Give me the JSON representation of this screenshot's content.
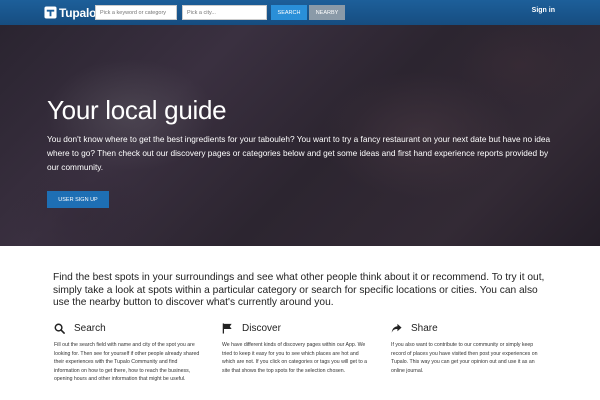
{
  "header": {
    "brand": "Tupalo",
    "search_placeholder": "Pick a keyword or category",
    "city_placeholder": "Pick a city...",
    "search_label": "SEARCH",
    "nearby_label": "NEARBY",
    "signin_label": "Sign in"
  },
  "hero": {
    "title": "Your local guide",
    "text": "You don't know where to get the best ingredients for your tabouleh? You want to try a fancy restaurant on your next date but have no idea where to go? Then check out our discovery pages or categories below and get some ideas and first hand experience reports provided by our community.",
    "signup_label": "USER SIGN UP"
  },
  "intro": {
    "text": "Find the best spots in your surroundings and see what other people think about it or recommend. To try it out, simply take a look at spots within a particular category or search for specific locations or cities. You can also use the nearby button to discover what's currently around you."
  },
  "features": [
    {
      "icon": "search-icon",
      "title": "Search",
      "text": "Fill out the search field with name and city of the spot you are looking for. Then see for yourself if other people already shared their experiences with the Tupalo Community and find information on how to get there, how to reach the business, opening hours and other information that might be useful."
    },
    {
      "icon": "flag-icon",
      "title": "Discover",
      "text": "We have different kinds of discovery pages within our App. We tried to keep it easy for you to see which places are hot and which are not. If you click on categories or tags you will get to a site that shows the top spots for the selection chosen."
    },
    {
      "icon": "share-arrow-icon",
      "title": "Share",
      "text": "If you also want to contribute to our community or simply keep record of places you have visited then post your experiences on Tupalo. This way you can get your opinion out and use it as an online journal."
    }
  ],
  "colors": {
    "navbar": "#1d5f9a",
    "search_button": "#2a8fd8",
    "nearby_button": "#8a9aa8",
    "signup_button": "#1e6fb4"
  }
}
